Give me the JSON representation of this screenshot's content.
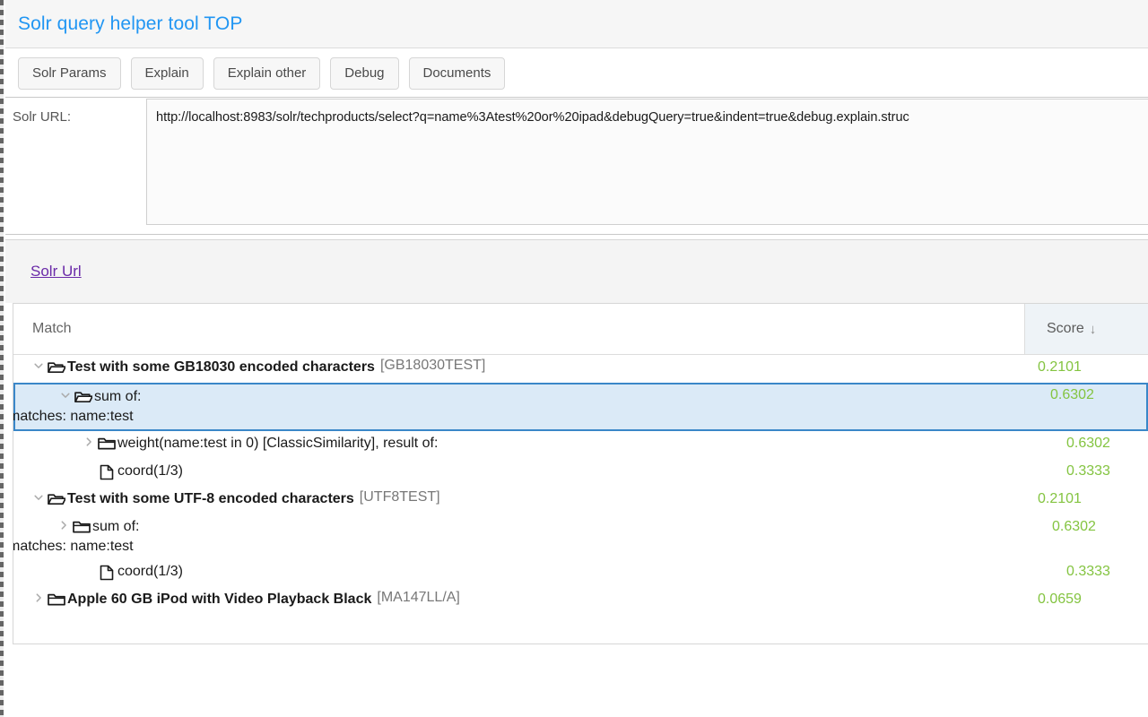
{
  "header": {
    "title": "Solr query helper tool TOP"
  },
  "tabs": [
    {
      "label": "Solr Params",
      "name": "tab-solr-params"
    },
    {
      "label": "Explain",
      "name": "tab-explain"
    },
    {
      "label": "Explain other",
      "name": "tab-explain-other"
    },
    {
      "label": "Debug",
      "name": "tab-debug"
    },
    {
      "label": "Documents",
      "name": "tab-documents"
    }
  ],
  "url_row": {
    "label": "Solr URL:",
    "value": "http://localhost:8983/solr/techproducts/select?q=name%3Atest%20or%20ipad&debugQuery=true&indent=true&debug.explain.struc"
  },
  "link_panel": {
    "solr_url_link": "Solr Url"
  },
  "table": {
    "columns": {
      "match": "Match",
      "score": "Score",
      "sort_indicator": "↓"
    },
    "rows": [
      {
        "depth": 0,
        "chevron": "down",
        "icon": "folder-open-icon",
        "text": "Test with some GB18030 encoded characters",
        "id": "[GB18030TEST]",
        "bold": true,
        "score": "0.2101",
        "selected": false,
        "matches": ""
      },
      {
        "depth": 1,
        "chevron": "down",
        "icon": "folder-open-icon",
        "text": "sum of:",
        "id": "",
        "bold": false,
        "score": "0.6302",
        "selected": true,
        "matches": "matches: name:test"
      },
      {
        "depth": 2,
        "chevron": "right",
        "icon": "folder-closed-icon",
        "text": "weight(name:test in 0) [ClassicSimilarity], result of:",
        "id": "",
        "bold": false,
        "score": "0.6302",
        "selected": false,
        "matches": ""
      },
      {
        "depth": 2,
        "chevron": "none",
        "icon": "file-icon",
        "text": "coord(1/3)",
        "id": "",
        "bold": false,
        "score": "0.3333",
        "selected": false,
        "matches": ""
      },
      {
        "depth": 0,
        "chevron": "down",
        "icon": "folder-open-icon",
        "text": "Test with some UTF-8 encoded characters",
        "id": "[UTF8TEST]",
        "bold": true,
        "score": "0.2101",
        "selected": false,
        "matches": ""
      },
      {
        "depth": 1,
        "chevron": "right",
        "icon": "folder-closed-icon",
        "text": "sum of:",
        "id": "",
        "bold": false,
        "score": "0.6302",
        "selected": false,
        "matches": "matches: name:test"
      },
      {
        "depth": 2,
        "chevron": "none",
        "icon": "file-icon",
        "text": "coord(1/3)",
        "id": "",
        "bold": false,
        "score": "0.3333",
        "selected": false,
        "matches": ""
      },
      {
        "depth": 0,
        "chevron": "right",
        "icon": "folder-closed-icon",
        "text": "Apple 60 GB iPod with Video Playback Black",
        "id": "[MA147LL/A]",
        "bold": true,
        "score": "0.0659",
        "selected": false,
        "matches": ""
      }
    ]
  },
  "colors": {
    "title_blue": "#2196f3",
    "score_green": "#84c441",
    "link_purple": "#6a2aa8",
    "selected_bg": "#dbeaf7",
    "selected_border": "#3a87c8",
    "sorted_header_bg": "#eef3f7"
  }
}
